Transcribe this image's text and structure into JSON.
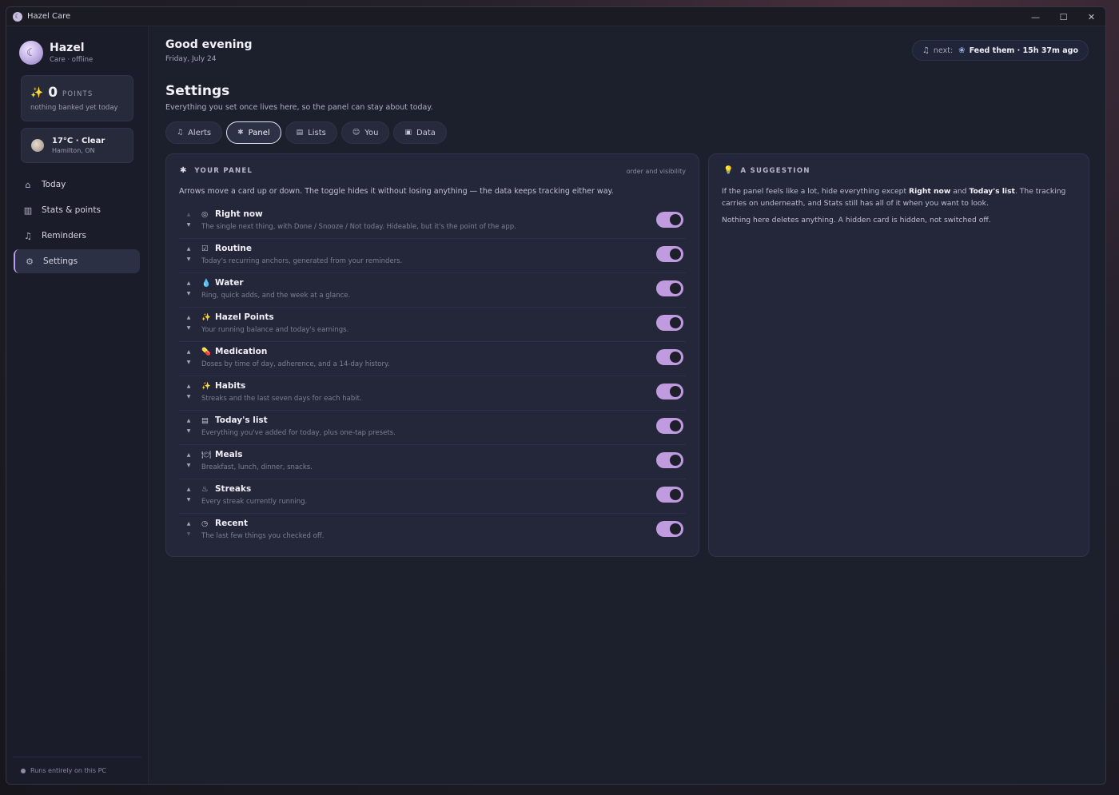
{
  "window": {
    "title": "Hazel Care",
    "controls": [
      "—",
      "☐",
      "✕"
    ]
  },
  "sidebar": {
    "profile": {
      "name": "Hazel",
      "status": "Care · offline"
    },
    "points": {
      "value": "0",
      "label": "POINTS",
      "sub": "nothing banked yet today"
    },
    "weather": {
      "main": "17°C · Clear",
      "location": "Hamilton, ON"
    },
    "nav": [
      {
        "label": "Today",
        "icon": "house-icon"
      },
      {
        "label": "Stats & points",
        "icon": "chart-icon"
      },
      {
        "label": "Reminders",
        "icon": "bell-icon"
      },
      {
        "label": "Settings",
        "icon": "gear-icon"
      }
    ],
    "footer": "Runs entirely on this PC"
  },
  "header": {
    "greeting": "Good evening",
    "date": "Friday, July 24",
    "next_label": "next:",
    "next_value": "Feed them · 15h 37m ago"
  },
  "settings": {
    "title": "Settings",
    "subtitle": "Everything you set once lives here, so the panel can stay about today.",
    "tabs": [
      "Alerts",
      "Panel",
      "Lists",
      "You",
      "Data"
    ],
    "active_tab": "Panel"
  },
  "panel": {
    "title": "YOUR PANEL",
    "meta": "order and visibility",
    "description": "Arrows move a card up or down. The toggle hides it without losing anything — the data keeps tracking either way.",
    "rows": [
      {
        "name": "Right now",
        "desc": "The single next thing, with Done / Snooze / Not today. Hideable, but it's the point of the app.",
        "icon": "target-icon",
        "enabled": true
      },
      {
        "name": "Routine",
        "desc": "Today's recurring anchors, generated from your reminders.",
        "icon": "checkbox-icon",
        "enabled": true
      },
      {
        "name": "Water",
        "desc": "Ring, quick adds, and the week at a glance.",
        "icon": "droplet-icon",
        "enabled": true
      },
      {
        "name": "Hazel Points",
        "desc": "Your running balance and today's earnings.",
        "icon": "sparkle-icon",
        "enabled": true
      },
      {
        "name": "Medication",
        "desc": "Doses by time of day, adherence, and a 14-day history.",
        "icon": "pill-icon",
        "enabled": true
      },
      {
        "name": "Habits",
        "desc": "Streaks and the last seven days for each habit.",
        "icon": "sparkle-icon",
        "enabled": true
      },
      {
        "name": "Today's list",
        "desc": "Everything you've added for today, plus one-tap presets.",
        "icon": "notepad-icon",
        "enabled": true
      },
      {
        "name": "Meals",
        "desc": "Breakfast, lunch, dinner, snacks.",
        "icon": "plate-icon",
        "enabled": true
      },
      {
        "name": "Streaks",
        "desc": "Every streak currently running.",
        "icon": "flame-icon",
        "enabled": true
      },
      {
        "name": "Recent",
        "desc": "The last few things you checked off.",
        "icon": "clock-icon",
        "enabled": true
      }
    ]
  },
  "suggestion": {
    "title": "A SUGGESTION",
    "p1_a": "If the panel feels like a lot, hide everything except ",
    "p1_b1": "Right now",
    "p1_c": " and ",
    "p1_b2": "Today's list",
    "p1_d": ". The tracking carries on underneath, and Stats still has all of it when you want to look.",
    "p2": "Nothing here deletes anything. A hidden card is hidden, not switched off."
  }
}
